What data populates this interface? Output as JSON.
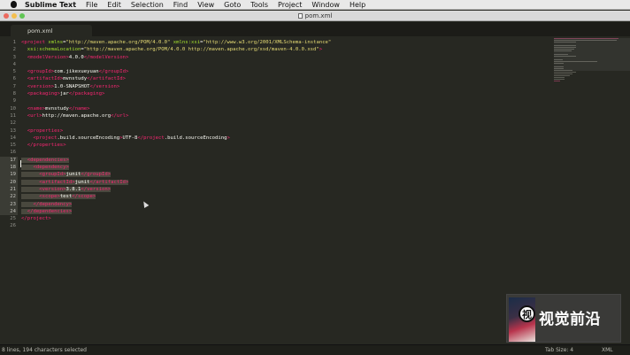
{
  "menubar": {
    "app_name": "Sublime Text",
    "items": [
      "File",
      "Edit",
      "Selection",
      "Find",
      "View",
      "Goto",
      "Tools",
      "Project",
      "Window",
      "Help"
    ]
  },
  "window": {
    "title": "pom.xml"
  },
  "tab": {
    "label": "pom.xml"
  },
  "editor": {
    "selected_lines": [
      17,
      18,
      19,
      20,
      21,
      22,
      23,
      24
    ],
    "lines": [
      [
        [
          "t",
          "<"
        ],
        [
          "t",
          "project"
        ],
        [
          "a",
          " xmlns"
        ],
        [
          "p",
          "="
        ],
        [
          "s",
          "\"http://maven.apache.org/POM/4.0.0\""
        ],
        [
          "a",
          " xmlns:xsi"
        ],
        [
          "p",
          "="
        ],
        [
          "s",
          "\"http://www.w3.org/2001/XMLSchema-instance\""
        ]
      ],
      [
        [
          "a",
          "  xsi:schemaLocation"
        ],
        [
          "p",
          "="
        ],
        [
          "s",
          "\"http://maven.apache.org/POM/4.0.0 http://maven.apache.org/xsd/maven-4.0.0.xsd\""
        ],
        [
          "t",
          ">"
        ]
      ],
      [
        [
          "p",
          "  "
        ],
        [
          "t",
          "<"
        ],
        [
          "t",
          "modelVersion"
        ],
        [
          "t",
          ">"
        ],
        [
          "p",
          "4.0.0"
        ],
        [
          "t",
          "</"
        ],
        [
          "t",
          "modelVersion"
        ],
        [
          "t",
          ">"
        ]
      ],
      [],
      [
        [
          "p",
          "  "
        ],
        [
          "t",
          "<"
        ],
        [
          "t",
          "groupId"
        ],
        [
          "t",
          ">"
        ],
        [
          "p",
          "com.jikexueyuan"
        ],
        [
          "t",
          "</"
        ],
        [
          "t",
          "groupId"
        ],
        [
          "t",
          ">"
        ]
      ],
      [
        [
          "p",
          "  "
        ],
        [
          "t",
          "<"
        ],
        [
          "t",
          "artifactId"
        ],
        [
          "t",
          ">"
        ],
        [
          "p",
          "mvnstudy"
        ],
        [
          "t",
          "</"
        ],
        [
          "t",
          "artifactId"
        ],
        [
          "t",
          ">"
        ]
      ],
      [
        [
          "p",
          "  "
        ],
        [
          "t",
          "<"
        ],
        [
          "t",
          "version"
        ],
        [
          "t",
          ">"
        ],
        [
          "p",
          "1.0-SNAPSHOT"
        ],
        [
          "t",
          "</"
        ],
        [
          "t",
          "version"
        ],
        [
          "t",
          ">"
        ]
      ],
      [
        [
          "p",
          "  "
        ],
        [
          "t",
          "<"
        ],
        [
          "t",
          "packaging"
        ],
        [
          "t",
          ">"
        ],
        [
          "p",
          "jar"
        ],
        [
          "t",
          "</"
        ],
        [
          "t",
          "packaging"
        ],
        [
          "t",
          ">"
        ]
      ],
      [],
      [
        [
          "p",
          "  "
        ],
        [
          "t",
          "<"
        ],
        [
          "t",
          "name"
        ],
        [
          "t",
          ">"
        ],
        [
          "p",
          "mvnstudy"
        ],
        [
          "t",
          "</"
        ],
        [
          "t",
          "name"
        ],
        [
          "t",
          ">"
        ]
      ],
      [
        [
          "p",
          "  "
        ],
        [
          "t",
          "<"
        ],
        [
          "t",
          "url"
        ],
        [
          "t",
          ">"
        ],
        [
          "p",
          "http://maven.apache.org"
        ],
        [
          "t",
          "</"
        ],
        [
          "t",
          "url"
        ],
        [
          "t",
          ">"
        ]
      ],
      [],
      [
        [
          "p",
          "  "
        ],
        [
          "t",
          "<"
        ],
        [
          "t",
          "properties"
        ],
        [
          "t",
          ">"
        ]
      ],
      [
        [
          "p",
          "    "
        ],
        [
          "t",
          "<"
        ],
        [
          "t",
          "project"
        ],
        [
          "p",
          ".build.sourceEncoding"
        ],
        [
          "t",
          ">"
        ],
        [
          "p",
          "UTF-8"
        ],
        [
          "t",
          "</"
        ],
        [
          "t",
          "project"
        ],
        [
          "p",
          ".build.sourceEncoding"
        ],
        [
          "t",
          ">"
        ]
      ],
      [
        [
          "p",
          "  "
        ],
        [
          "t",
          "</"
        ],
        [
          "t",
          "properties"
        ],
        [
          "t",
          ">"
        ]
      ],
      [],
      [
        [
          "p",
          "  "
        ],
        [
          "t",
          "<"
        ],
        [
          "t",
          "dependencies"
        ],
        [
          "t",
          ">"
        ]
      ],
      [
        [
          "p",
          "    "
        ],
        [
          "t",
          "<"
        ],
        [
          "t",
          "dependency"
        ],
        [
          "t",
          ">"
        ]
      ],
      [
        [
          "p",
          "      "
        ],
        [
          "t",
          "<"
        ],
        [
          "t",
          "groupId"
        ],
        [
          "t",
          ">"
        ],
        [
          "p",
          "junit"
        ],
        [
          "t",
          "</"
        ],
        [
          "t",
          "groupId"
        ],
        [
          "t",
          ">"
        ]
      ],
      [
        [
          "p",
          "      "
        ],
        [
          "t",
          "<"
        ],
        [
          "t",
          "artifactId"
        ],
        [
          "t",
          ">"
        ],
        [
          "p",
          "junit"
        ],
        [
          "t",
          "</"
        ],
        [
          "t",
          "artifactId"
        ],
        [
          "t",
          ">"
        ]
      ],
      [
        [
          "p",
          "      "
        ],
        [
          "t",
          "<"
        ],
        [
          "t",
          "version"
        ],
        [
          "t",
          ">"
        ],
        [
          "p",
          "3.8.1"
        ],
        [
          "t",
          "</"
        ],
        [
          "t",
          "version"
        ],
        [
          "t",
          ">"
        ]
      ],
      [
        [
          "p",
          "      "
        ],
        [
          "t",
          "<"
        ],
        [
          "t",
          "scope"
        ],
        [
          "t",
          ">"
        ],
        [
          "p",
          "test"
        ],
        [
          "t",
          "</"
        ],
        [
          "t",
          "scope"
        ],
        [
          "t",
          ">"
        ]
      ],
      [
        [
          "p",
          "    "
        ],
        [
          "t",
          "</"
        ],
        [
          "t",
          "dependency"
        ],
        [
          "t",
          ">"
        ]
      ],
      [
        [
          "p",
          "  "
        ],
        [
          "t",
          "</"
        ],
        [
          "t",
          "dependencies"
        ],
        [
          "t",
          ">"
        ]
      ],
      [
        [
          "t",
          "</"
        ],
        [
          "t",
          "project"
        ],
        [
          "t",
          ">"
        ]
      ],
      []
    ]
  },
  "watermark": {
    "badge": "视",
    "text": "视觉前沿"
  },
  "statusbar": {
    "left": "8 lines, 194 characters selected",
    "tab_size": "Tab Size: 4",
    "syntax": "XML"
  },
  "colors": {
    "background": "#272822",
    "tag": "#f92672",
    "attribute": "#a6e22e",
    "string": "#e6db74",
    "text": "#f8f8f2",
    "selection": "#49483e"
  }
}
